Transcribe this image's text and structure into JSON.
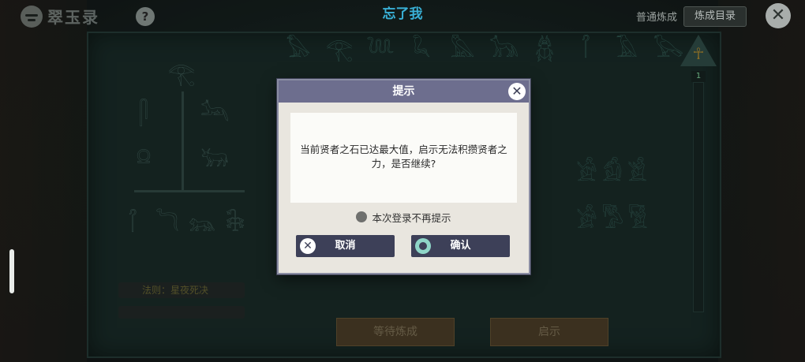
{
  "app": {
    "logo_text": "翠玉录",
    "help_label": "?"
  },
  "header": {
    "title": "忘了我",
    "mode_label": "普通炼成",
    "catalog_label": "炼成目录"
  },
  "board": {
    "rule_label": "法则：星夜死决",
    "level_value": "1",
    "wait_button_label": "等待炼成",
    "reveal_button_label": "启示"
  },
  "dialog": {
    "title": "提示",
    "message": "当前贤者之石已达最大值，启示无法积攒贤者之力，是否继续?",
    "dont_show_label": "本次登录不再提示",
    "cancel_label": "取消",
    "confirm_label": "确认"
  },
  "colors": {
    "title_accent": "#39b0d6",
    "dialog_header": "#6d6e8e",
    "button_bg": "#3d4058"
  },
  "icons": [
    "logo-icon",
    "help-icon",
    "close-icon",
    "ankh-icon",
    "hieroglyph-icon"
  ]
}
